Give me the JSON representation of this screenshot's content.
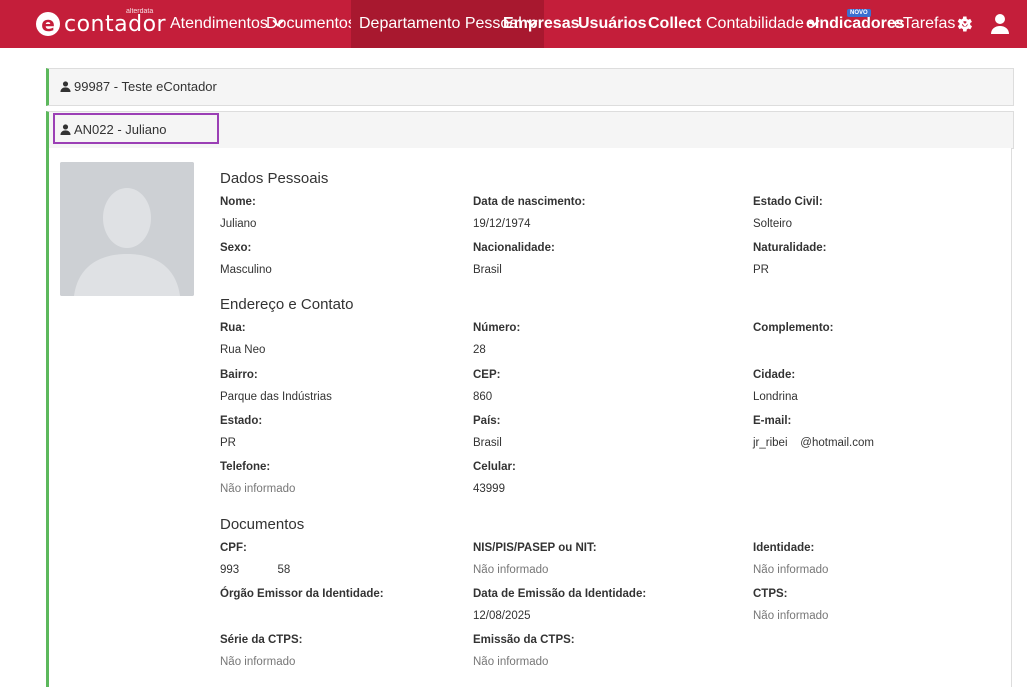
{
  "brand": {
    "name": "contador",
    "sub": "alterdata"
  },
  "nav": {
    "atendimentos": "Atendimentos",
    "documentos": "Documentos",
    "departamento": "Departamento Pessoal",
    "empresas": "Empresas",
    "usuarios": "Usuários",
    "collect": "Collect",
    "contabilidade": "Contabilidade",
    "eindicadores": "eIndicadores",
    "novo_badge": "NOVO",
    "etarefas": "eTarefas"
  },
  "panels": {
    "company": "99987 - Teste eContador",
    "employee": "AN022 - Juliano"
  },
  "sections": {
    "pessoais": "Dados Pessoais",
    "endereco": "Endereço e Contato",
    "documentos": "Documentos"
  },
  "fields": {
    "nome": {
      "label": "Nome:",
      "value": "Juliano"
    },
    "nascimento": {
      "label": "Data de nascimento:",
      "value": "19/12/1974"
    },
    "estado_civil": {
      "label": "Estado Civil:",
      "value": "Solteiro"
    },
    "sexo": {
      "label": "Sexo:",
      "value": "Masculino"
    },
    "nacionalidade": {
      "label": "Nacionalidade:",
      "value": "Brasil"
    },
    "naturalidade": {
      "label": "Naturalidade:",
      "value": "PR"
    },
    "rua": {
      "label": "Rua:",
      "value": "Rua Neo"
    },
    "numero": {
      "label": "Número:",
      "value": "28"
    },
    "complemento": {
      "label": "Complemento:",
      "value": ""
    },
    "bairro": {
      "label": "Bairro:",
      "value": "Parque das Indústrias"
    },
    "cep": {
      "label": "CEP:",
      "value": "860"
    },
    "cidade": {
      "label": "Cidade:",
      "value": "Londrina"
    },
    "estado": {
      "label": "Estado:",
      "value": "PR"
    },
    "pais": {
      "label": "País:",
      "value": "Brasil"
    },
    "email": {
      "label": "E-mail:",
      "value": "jr_ribei    @hotmail.com"
    },
    "telefone": {
      "label": "Telefone:",
      "value": "Não informado"
    },
    "celular": {
      "label": "Celular:",
      "value": "43999"
    },
    "cpf": {
      "label": "CPF:",
      "value": "993            58"
    },
    "nis": {
      "label": "NIS/PIS/PASEP ou NIT:",
      "value": "Não informado"
    },
    "identidade": {
      "label": "Identidade:",
      "value": "Não informado"
    },
    "orgao": {
      "label": "Órgão Emissor da Identidade:",
      "value": ""
    },
    "emissao_id": {
      "label": "Data de Emissão da Identidade:",
      "value": "12/08/2025"
    },
    "ctps": {
      "label": "CTPS:",
      "value": "Não informado"
    },
    "serie_ctps": {
      "label": "Série da CTPS:",
      "value": "Não informado"
    },
    "emissao_ctps": {
      "label": "Emissão da CTPS:",
      "value": "Não informado"
    }
  },
  "colors": {
    "brand": "#c41e3a",
    "accent_green": "#5cb85c",
    "highlight": "#9b3fb5"
  },
  "icons": [
    "gear-icon",
    "user-icon",
    "chevron-down-icon",
    "avatar-placeholder"
  ]
}
